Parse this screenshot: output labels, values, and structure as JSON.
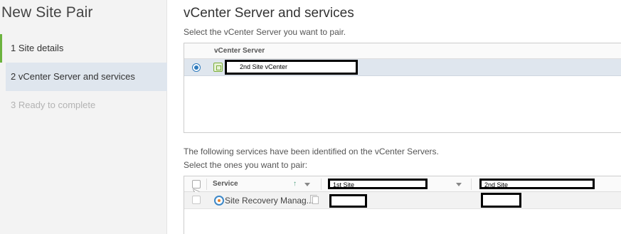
{
  "wizard": {
    "title": "New Site Pair",
    "steps": [
      {
        "label": "1  Site details",
        "state": "done"
      },
      {
        "label": "2  vCenter Server and services",
        "state": "active"
      },
      {
        "label": "3  Ready to complete",
        "state": "disabled"
      }
    ]
  },
  "main": {
    "title": "vCenter Server and services",
    "instruction_vc": "Select the vCenter Server you want to pair.",
    "vc_grid": {
      "column_header": "vCenter Server",
      "rows": [
        {
          "name": "2nd Site vCenter",
          "selected": true
        }
      ]
    },
    "services_text_1": "The following services have been identified on the vCenter Servers.",
    "services_text_2": "Select the ones you want to pair:",
    "services_grid": {
      "headers": {
        "service": "Service",
        "site1": "1st Site",
        "site2": "2nd Site"
      },
      "rows": [
        {
          "service": "Site Recovery Manag...",
          "site1": "",
          "site2": ""
        }
      ]
    }
  },
  "colors": {
    "accent": "#2f7bbd",
    "selected_row": "#dfe6ee",
    "done_step": "#6cb33e"
  }
}
